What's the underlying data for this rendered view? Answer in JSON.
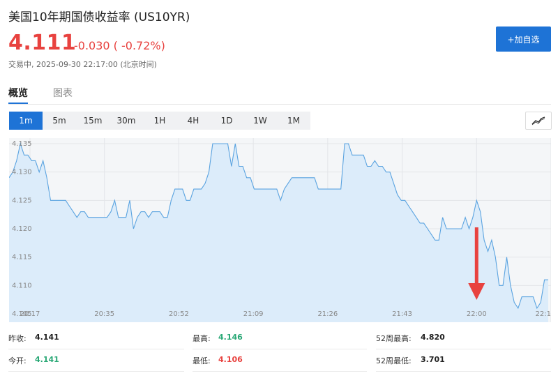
{
  "header": {
    "title": "美国10年期国债收益率 (US10YR)",
    "price": "4.111",
    "change": "-0.030 ( -0.72%)",
    "status": "交易中, 2025-09-30 22:17:00 (北京时间)",
    "add_button": "+加自选"
  },
  "main_tabs": [
    {
      "label": "概览",
      "active": true
    },
    {
      "label": "图表",
      "active": false
    }
  ],
  "intervals": [
    {
      "label": "1m",
      "active": true
    },
    {
      "label": "5m",
      "active": false
    },
    {
      "label": "15m",
      "active": false
    },
    {
      "label": "30m",
      "active": false
    },
    {
      "label": "1H",
      "active": false
    },
    {
      "label": "4H",
      "active": false
    },
    {
      "label": "1D",
      "active": false
    },
    {
      "label": "1W",
      "active": false
    },
    {
      "label": "1M",
      "active": false
    }
  ],
  "chart_type_icon": "line-chart-icon",
  "chart_data": {
    "type": "area",
    "x_ticks": [
      "20:17",
      "20:35",
      "20:52",
      "21:09",
      "21:26",
      "21:43",
      "22:00",
      "22:1"
    ],
    "y_ticks": [
      "4.135",
      "4.130",
      "4.125",
      "4.120",
      "4.115",
      "4.110",
      "4.105"
    ],
    "ylim": [
      4.105,
      4.135
    ],
    "values": [
      4.129,
      4.13,
      4.132,
      4.135,
      4.133,
      4.133,
      4.132,
      4.132,
      4.13,
      4.132,
      4.129,
      4.125,
      4.125,
      4.125,
      4.125,
      4.125,
      4.124,
      4.123,
      4.122,
      4.123,
      4.123,
      4.122,
      4.122,
      4.122,
      4.122,
      4.122,
      4.122,
      4.123,
      4.125,
      4.122,
      4.122,
      4.122,
      4.125,
      4.12,
      4.122,
      4.123,
      4.123,
      4.122,
      4.123,
      4.123,
      4.123,
      4.122,
      4.122,
      4.125,
      4.127,
      4.127,
      4.127,
      4.125,
      4.125,
      4.127,
      4.127,
      4.127,
      4.128,
      4.13,
      4.135,
      4.135,
      4.135,
      4.135,
      4.135,
      4.131,
      4.135,
      4.131,
      4.131,
      4.129,
      4.129,
      4.127,
      4.127,
      4.127,
      4.127,
      4.127,
      4.127,
      4.127,
      4.125,
      4.127,
      4.128,
      4.129,
      4.129,
      4.129,
      4.129,
      4.129,
      4.129,
      4.129,
      4.127,
      4.127,
      4.127,
      4.127,
      4.127,
      4.127,
      4.127,
      4.135,
      4.135,
      4.133,
      4.133,
      4.133,
      4.133,
      4.131,
      4.131,
      4.132,
      4.131,
      4.131,
      4.13,
      4.13,
      4.128,
      4.126,
      4.125,
      4.125,
      4.124,
      4.123,
      4.122,
      4.121,
      4.121,
      4.12,
      4.119,
      4.118,
      4.118,
      4.122,
      4.12,
      4.12,
      4.12,
      4.12,
      4.12,
      4.122,
      4.12,
      4.122,
      4.125,
      4.123,
      4.118,
      4.116,
      4.118,
      4.115,
      4.11,
      4.11,
      4.115,
      4.11,
      4.107,
      4.106,
      4.108,
      4.108,
      4.108,
      4.108,
      4.106,
      4.107,
      4.111,
      4.111
    ],
    "colors": {
      "line": "#5aa3e0",
      "fill": "#dcecfa",
      "arrow": "#e8423f",
      "grid": "#e3e5e8"
    },
    "annotation": "red-down-arrow-at-22:00"
  },
  "stats": [
    {
      "label": "昨收:",
      "value": "4.141",
      "color": "black"
    },
    {
      "label": "最高:",
      "value": "4.146",
      "color": "green"
    },
    {
      "label": "52周最高:",
      "value": "4.820",
      "color": "black"
    },
    {
      "label": "今开:",
      "value": "4.141",
      "color": "green"
    },
    {
      "label": "最低:",
      "value": "4.106",
      "color": "red"
    },
    {
      "label": "52周最低:",
      "value": "3.701",
      "color": "black"
    }
  ]
}
